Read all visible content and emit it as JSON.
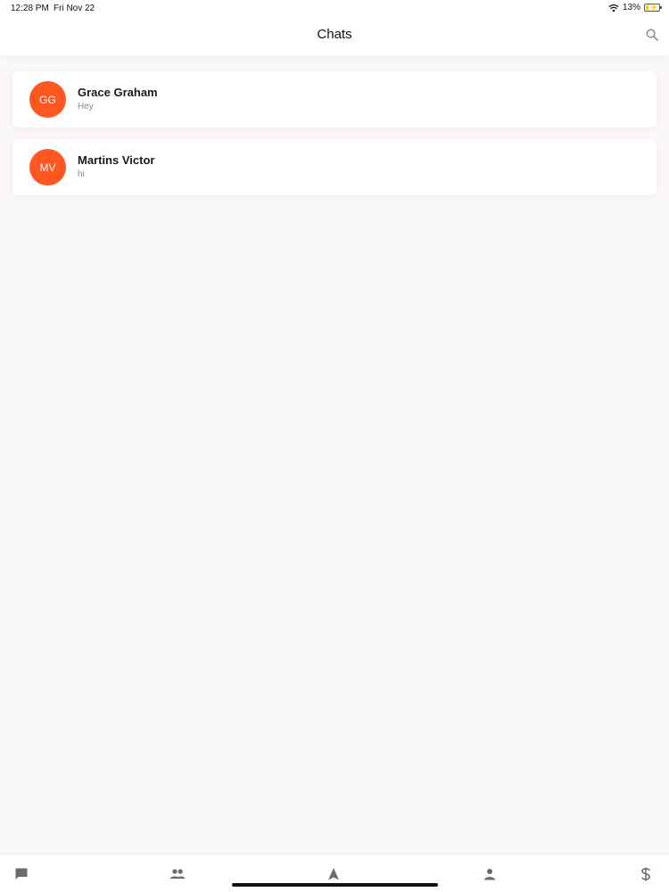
{
  "status_bar": {
    "time": "12:28 PM",
    "date": "Fri Nov 22",
    "battery": "13%"
  },
  "nav": {
    "title": "Chats"
  },
  "chats": [
    {
      "initials": "GG",
      "name": "Grace Graham",
      "last_message": "Hey"
    },
    {
      "initials": "MV",
      "name": "Martins Victor",
      "last_message": "hi"
    }
  ],
  "tabs": [
    {
      "icon": "chat-bubble-icon"
    },
    {
      "icon": "people-icon"
    },
    {
      "icon": "navigation-arrow-icon"
    },
    {
      "icon": "person-icon"
    },
    {
      "icon": "dollar-icon"
    }
  ],
  "colors": {
    "accent": "#ff5722",
    "background": "#faf8f8"
  }
}
